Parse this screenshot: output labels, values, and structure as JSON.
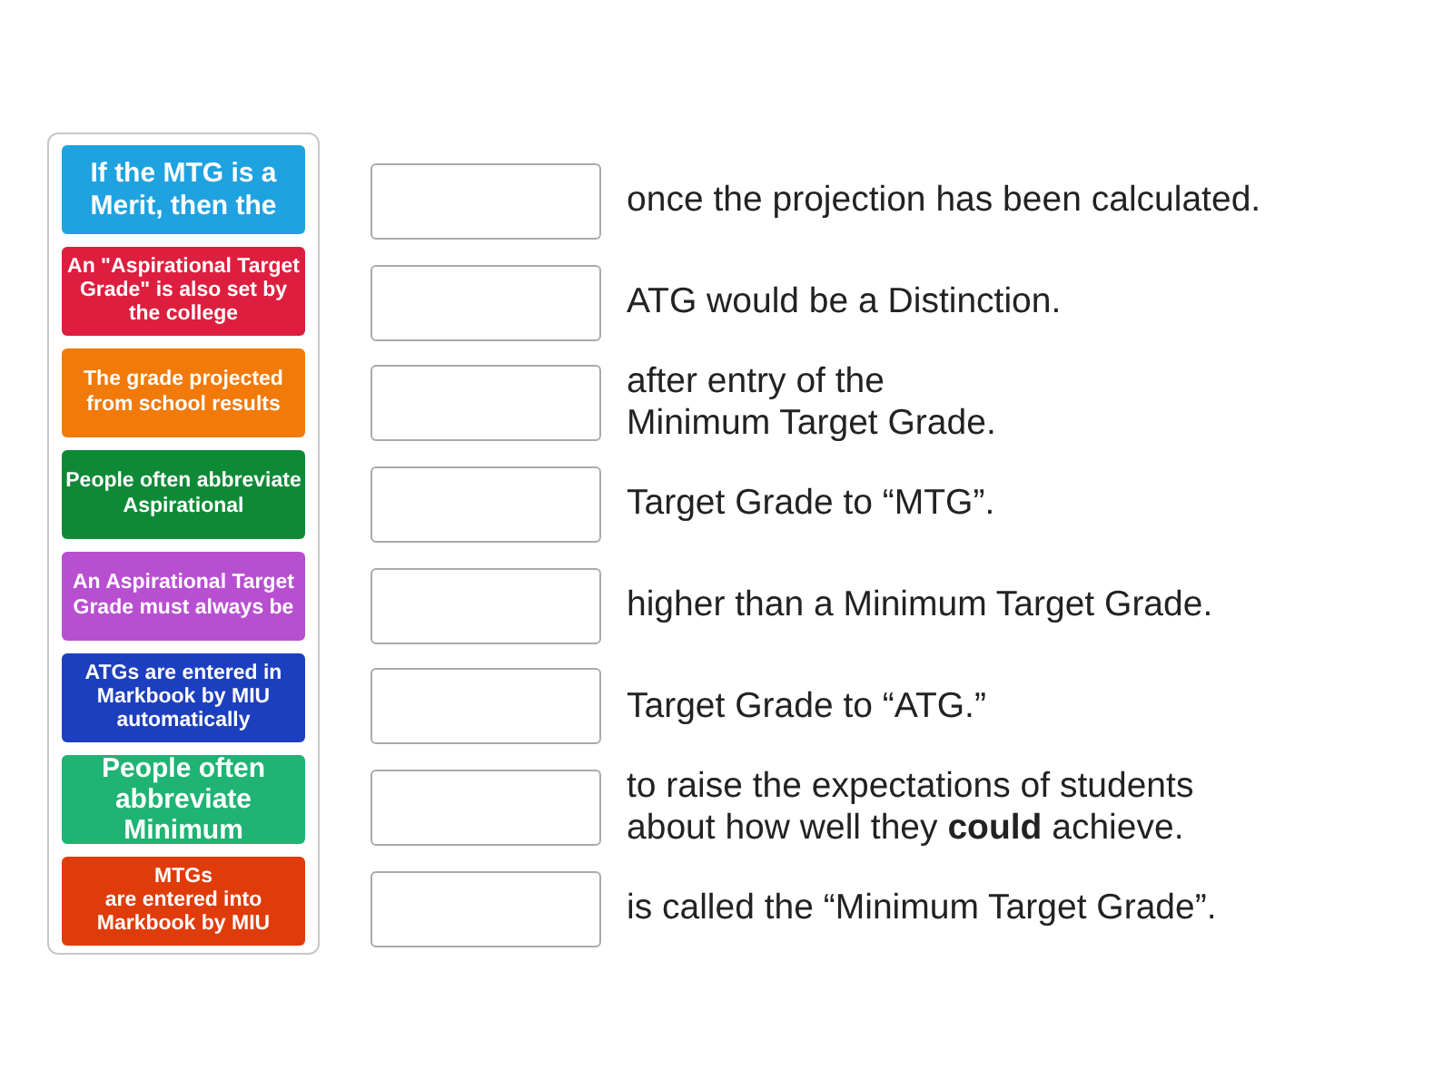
{
  "tiles": [
    {
      "text": "If the MTG is a Merit, then the",
      "color": "#1fa2e0"
    },
    {
      "text": "An \"Aspirational Target Grade\" is also set by the college",
      "color": "#dd1e3f"
    },
    {
      "text": "The grade projected from school results",
      "color": "#f17a0a"
    },
    {
      "text": "People often abbreviate Aspirational",
      "color": "#0e8a37"
    },
    {
      "text": "An Aspirational Target Grade must always be",
      "color": "#b84fd1"
    },
    {
      "text": "ATGs are entered in Markbook by MIU automatically",
      "color": "#1c3fbf"
    },
    {
      "text": "People often abbreviate Minimum",
      "color": "#1fb374"
    },
    {
      "text": "MTGs\nare entered into Markbook by MIU",
      "color": "#e03c0b"
    }
  ],
  "rows": [
    {
      "text": "once the projection has been calculated."
    },
    {
      "text": "ATG would be a Distinction."
    },
    {
      "text": "after entry of the\nMinimum Target Grade."
    },
    {
      "text": "Target Grade to “MTG”."
    },
    {
      "text": "higher than a Minimum Target Grade."
    },
    {
      "text": "Target Grade to “ATG.”"
    },
    {
      "text": "to raise the expectations of students\nabout how well they **could** achieve."
    },
    {
      "text": "is called the “Minimum Target Grade”."
    }
  ]
}
